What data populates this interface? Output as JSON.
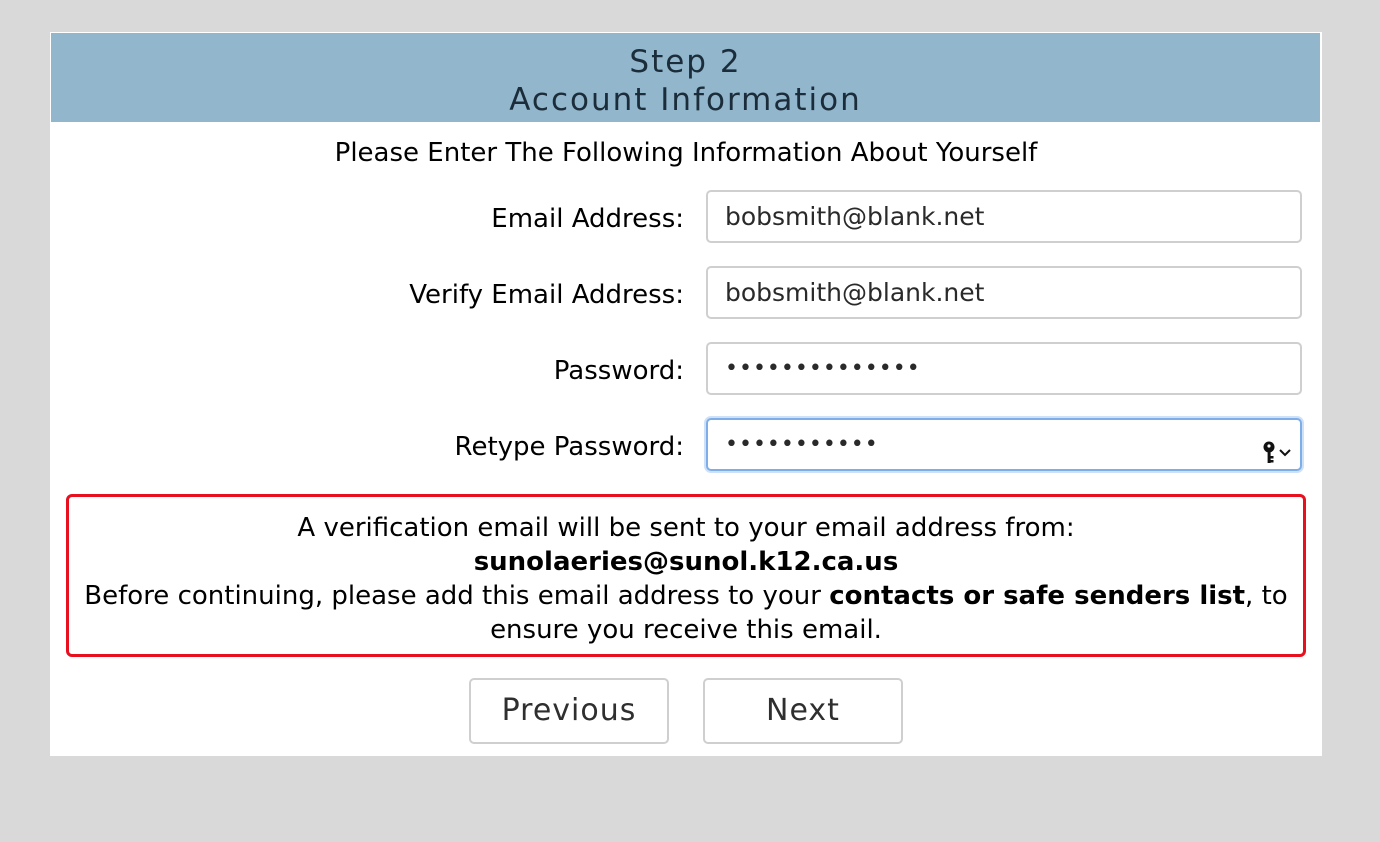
{
  "header": {
    "step": "Step 2",
    "title": "Account Information"
  },
  "intro": "Please Enter The Following Information About Yourself",
  "form": {
    "email": {
      "label": "Email Address:",
      "value": "bobsmith@blank.net"
    },
    "verify_email": {
      "label": "Verify Email Address:",
      "value": "bobsmith@blank.net"
    },
    "password": {
      "label": "Password:",
      "value": "••••••••••••••"
    },
    "retype_password": {
      "label": "Retype Password:",
      "value": "•••••••••••"
    }
  },
  "notice": {
    "line1": "A verification email will be sent to your email address from:",
    "sender_email": "sunolaeries@sunol.k12.ca.us",
    "line3_prefix": "Before continuing, please add this email address to your ",
    "line3_bold": "contacts or safe senders list",
    "line3_suffix": ", to ensure you receive this email."
  },
  "buttons": {
    "previous": "Previous",
    "next": "Next"
  },
  "colors": {
    "header_bg": "#92b6cc",
    "notice_border": "#e8101e",
    "focus_ring": "#7eaee8",
    "page_bg": "#d9d9d9"
  },
  "icons": {
    "password_manager": "key-dropdown-icon"
  }
}
